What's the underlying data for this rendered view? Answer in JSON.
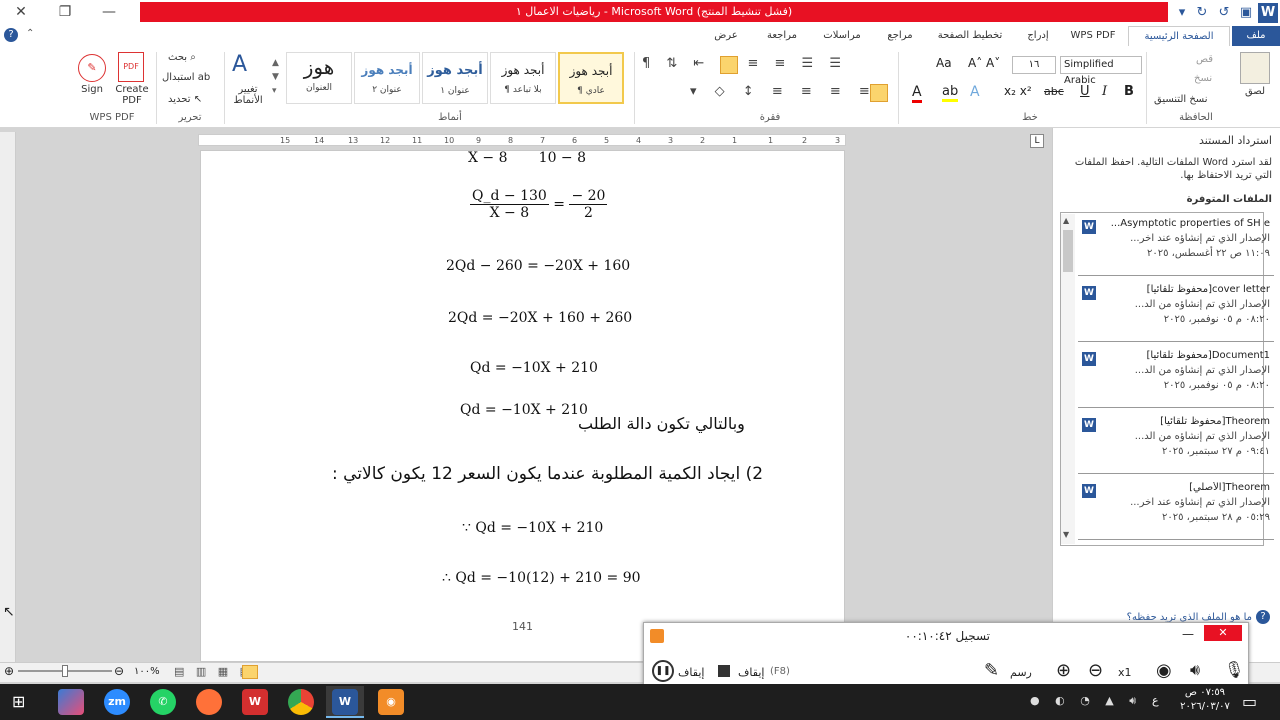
{
  "window": {
    "title": "رياضيات الاعمال ١ - Microsoft Word (فشل تنشيط المنتج)"
  },
  "tabs": [
    "ملف",
    "الصفحة الرئيسية",
    "WPS PDF",
    "إدراج",
    "تخطيط الصفحة",
    "مراجع",
    "مراسلات",
    "مراجعة",
    "عرض"
  ],
  "ribbon": {
    "clipboard": {
      "paste": "لصق",
      "cut": "قص",
      "copy": "نسخ",
      "format_painter": "نسخ التنسيق",
      "label": "الحافظة"
    },
    "font": {
      "name": "Simplified Arabic",
      "size": "١٦",
      "label": "خط"
    },
    "paragraph": {
      "label": "فقرة"
    },
    "styles": {
      "items": [
        {
          "preview": "أبجد هوز",
          "name": "¶ عادي"
        },
        {
          "preview": "أبجد هوز",
          "name": "¶ بلا تباعد"
        },
        {
          "preview": "أبجد هوز",
          "name": "عنوان ١"
        },
        {
          "preview": "أبجد هوز",
          "name": "عنوان ٢"
        },
        {
          "preview": "هوز",
          "name": "العنوان"
        }
      ],
      "change": "تغيير الأنماط",
      "label": "أنماط"
    },
    "editing": {
      "find": "بحث",
      "replace": "استبدال",
      "select": "تحديد",
      "label": "تحرير"
    },
    "wps": {
      "create": "Create PDF",
      "sign": "Sign",
      "label": "WPS PDF"
    }
  },
  "ruler": [
    "3",
    "2",
    "1",
    "1",
    "2",
    "3",
    "4",
    "5",
    "6",
    "7",
    "8",
    "9",
    "10",
    "11",
    "12",
    "13",
    "14",
    "15"
  ],
  "document": {
    "eq_top": [
      "X − 8",
      "10 − 8"
    ],
    "eq1": {
      "num_l": "Q_d − 130",
      "den_l": "X − 8",
      "num_r": "− 20",
      "den_r": "2"
    },
    "eq2": "2Qd − 260 = −20X + 160",
    "eq3": "2Qd = −20X + 160 + 260",
    "eq4": "Qd = −10X + 210",
    "eq5_math": "Qd = −10X + 210",
    "eq5_text": "وبالتالي تكون دالة الطلب",
    "heading": "2) ايجاد الكمية المطلوبة عندما يكون السعر  12 يكون كالاتي  :",
    "eq6": "∵ Qd = −10X + 210",
    "eq7": "∴ Qd = −10(12) + 210 = 90",
    "page_number": "141"
  },
  "panel": {
    "title": "استرداد المستند",
    "desc": "لقد استرد Word الملفات التالية. احفظ الملفات التي تريد الاحتفاظ بها.",
    "available": "الملفات المتوفرة",
    "files": [
      {
        "name": "Asymptotic properties of SH e...",
        "line2": "الإصدار الذي تم إنشاؤه عند آخر...",
        "line3": "١١:٠٩ ص ٢٢ أغسطس، ٢٠٢٥"
      },
      {
        "name": "cover letter[محفوظ تلقائياً]",
        "line2": "الإصدار الذي تم إنشاؤه من الد...",
        "line3": "٠٨:٢٠ م ٠٥ نوفمبر، ٢٠٢٥"
      },
      {
        "name": "Document1[محفوظ تلقائياً]",
        "line2": "الإصدار الذي تم إنشاؤه من الد...",
        "line3": "٠٨:٢٠ م ٠٥ نوفمبر، ٢٠٢٥"
      },
      {
        "name": "Theorem[محفوظ تلقائياً]",
        "line2": "الإصدار الذي تم إنشاؤه من الد...",
        "line3": "٠٩:٤١ م ٢٧ سبتمبر، ٢٠٢٥"
      },
      {
        "name": "Theorem[الأصلي]",
        "line2": "الإصدار الذي تم إنشاؤه عند آخر...",
        "line3": "٠٥:٢٩ م ٢٨ سبتمبر، ٢٠٢٥"
      }
    ],
    "help_link": "ما هو الملف الذي تريد حفظه؟"
  },
  "status": {
    "zoom": "١٠٠%"
  },
  "recorder": {
    "title": "تسجيل ٠٠:١٠:٤٢",
    "pause": "إيقاف",
    "stop": "إيقاف",
    "stop_key": "(F8)",
    "draw": "رسم",
    "zoom": "x1"
  },
  "taskbar": {
    "time": "٠٧:٥٩ ص",
    "date": "٢٠٢٦/٠٣/٠٧",
    "lang": "ع"
  }
}
